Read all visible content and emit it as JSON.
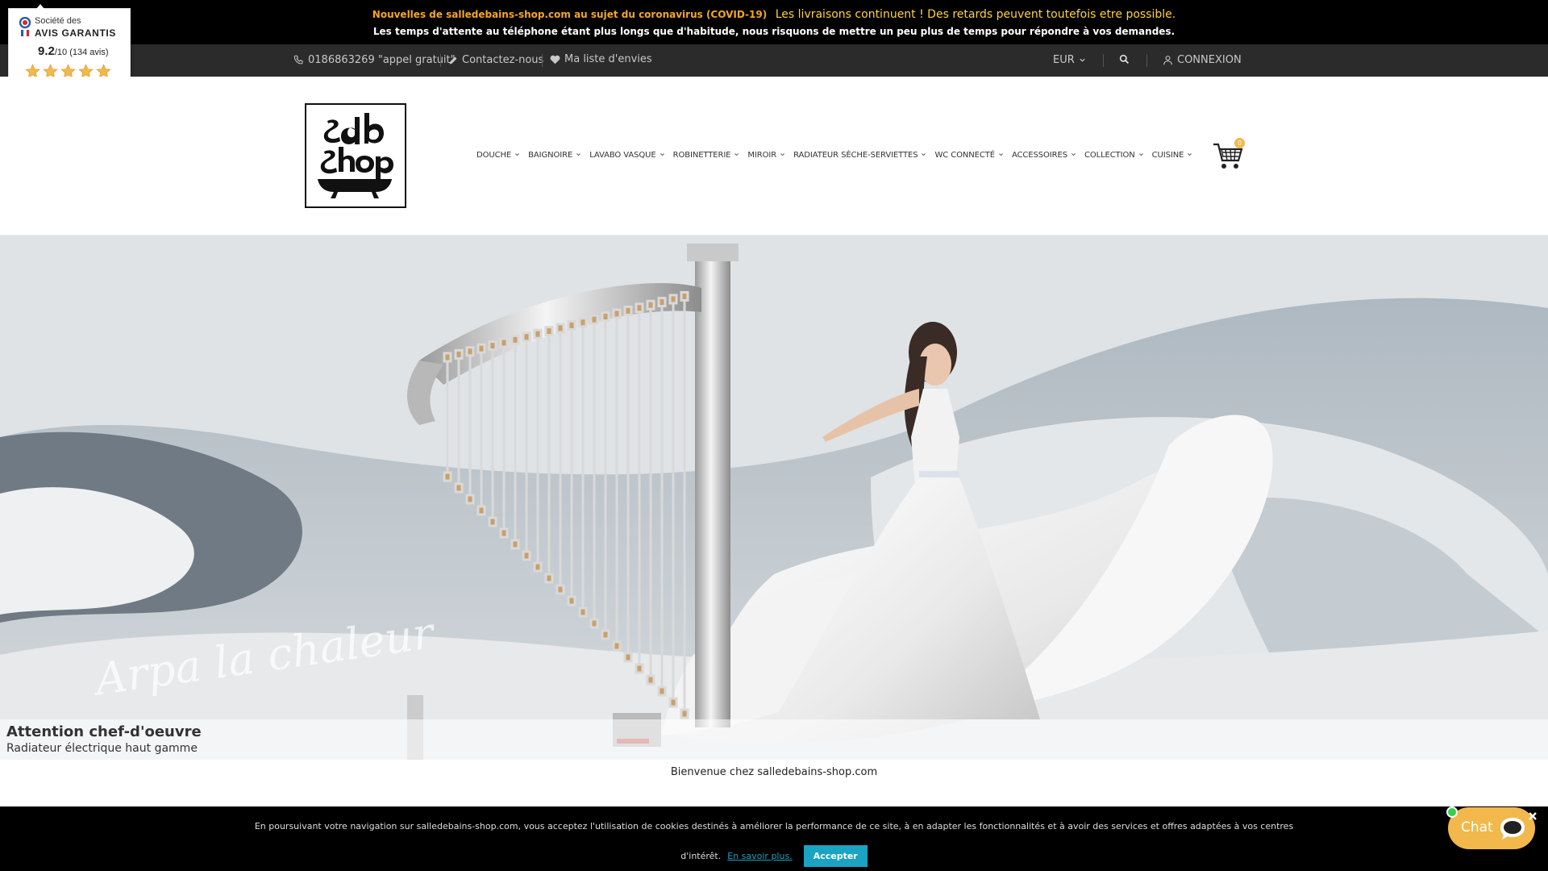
{
  "announcement": {
    "lead": "Nouvelles de salledebains-shop.com au sujet du coronavirus (COVID-19)",
    "highlight": "Les livraisons continuent ! Des retards peuvent toutefois etre possible.",
    "line2": "Les temps d'attente au téléphone étant plus longs que d'habitude, nous risquons de mettre un peu plus de temps pour répondre à vos demandes."
  },
  "utility": {
    "phone": "0186863269 \"appel gratuit\"",
    "contact": "Contactez-nous",
    "wishlist": "Ma liste d'envies",
    "currency": "EUR",
    "login": "CONNEXION"
  },
  "badge": {
    "brand_small": "Société des",
    "brand_big": "AVIS GARANTIS",
    "score": "9.2",
    "score_suffix": "/10 (134 avis)",
    "rating_stars": 5
  },
  "nav": {
    "items": [
      {
        "label": "DOUCHE"
      },
      {
        "label": "BAIGNOIRE"
      },
      {
        "label": "LAVABO VASQUE"
      },
      {
        "label": "ROBINETTERIE"
      },
      {
        "label": "MIROIR"
      },
      {
        "label": "RADIATEUR SÈCHE-SERVIETTES"
      },
      {
        "label": "WC CONNECTÉ"
      },
      {
        "label": "ACCESSOIRES"
      },
      {
        "label": "COLLECTION"
      },
      {
        "label": "CUISINE"
      }
    ]
  },
  "cart": {
    "count": "0"
  },
  "hero": {
    "title": "Attention chef-d'oeuvre",
    "subtitle": "Radiateur électrique haut gamme",
    "script_text": "Arpa la chaleur"
  },
  "welcome": "Bienvenue chez salledebains-shop.com",
  "cookie": {
    "text1": "En poursuivant votre navigation sur salledebains-shop.com, vous acceptez l'utilisation de cookies destinés à améliorer la performance de ce site, à en adapter les fonctionnalités et à avoir des services et offres adaptées à vos centres",
    "text2": "d'intérêt.",
    "more": "En savoir plus.",
    "accept": "Accepter"
  },
  "chat": {
    "label": "Chat"
  },
  "colors": {
    "accent_orange": "#f2b84b",
    "cookie_button": "#1aa3c2",
    "online": "#35d04a"
  }
}
